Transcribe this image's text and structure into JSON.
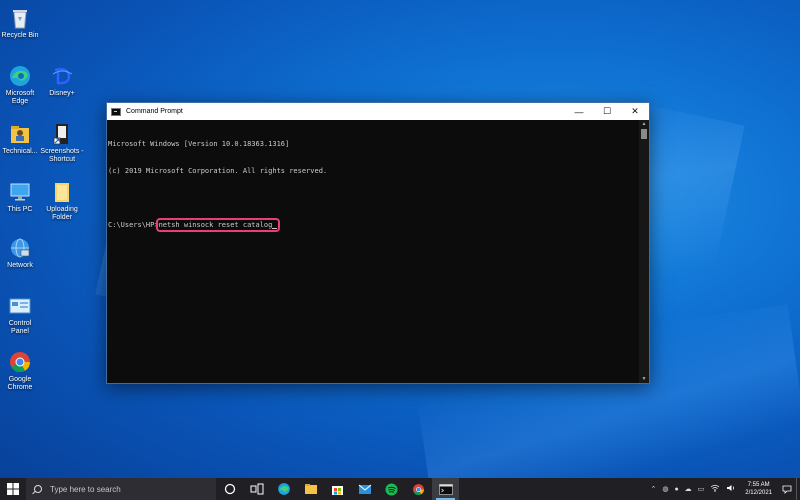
{
  "desktop": {
    "icons": [
      {
        "label": "Recycle Bin",
        "icon": "recycle-bin-icon"
      },
      {
        "label": "Microsoft\nEdge",
        "icon": "edge-icon"
      },
      {
        "label": "Disney+",
        "icon": "disney-plus-icon"
      },
      {
        "label": "Technical...",
        "icon": "user-folder-icon"
      },
      {
        "label": "Screenshots -\nShortcut",
        "icon": "shortcut-icon"
      },
      {
        "label": "This PC",
        "icon": "this-pc-icon"
      },
      {
        "label": "Uploading\nFolder",
        "icon": "folder-icon"
      },
      {
        "label": "Network",
        "icon": "network-icon"
      },
      {
        "label": "Control\nPanel",
        "icon": "control-panel-icon"
      },
      {
        "label": "Google\nChrome",
        "icon": "chrome-icon"
      }
    ]
  },
  "cmd": {
    "title": "Command Prompt",
    "lines": [
      "Microsoft Windows [Version 10.0.18363.1316]",
      "(c) 2019 Microsoft Corporation. All rights reserved.",
      ""
    ],
    "prompt": "C:\\Users\\HP>",
    "command": "netsh winsock reset catalog",
    "highlight_color": "#e83e7a",
    "controls": {
      "minimize": "—",
      "maximize": "☐",
      "close": "✕"
    }
  },
  "taskbar": {
    "search_placeholder": "Type here to search",
    "pinned": [
      "cortana-icon",
      "task-view-icon",
      "edge-icon",
      "file-explorer-icon",
      "store-icon",
      "mail-icon",
      "spotify-icon",
      "chrome-icon",
      "command-prompt-icon"
    ],
    "clock_time": "7:55 AM",
    "clock_date": "2/12/2021"
  }
}
